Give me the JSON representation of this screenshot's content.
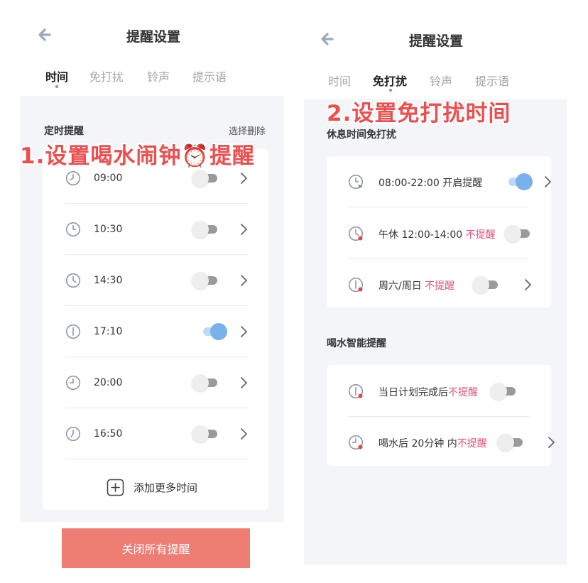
{
  "left": {
    "title": "提醒设置",
    "tabs": [
      {
        "label": "时间",
        "active": true
      },
      {
        "label": "免打扰",
        "active": false
      },
      {
        "label": "铃声",
        "active": false
      },
      {
        "label": "提示语",
        "active": false
      }
    ],
    "section_label": "定时提醒",
    "select_delete_label": "选择删除",
    "annotation": "1.设置喝水闹钟⏰提醒",
    "reminders": [
      {
        "time": "09:00",
        "enabled": false
      },
      {
        "time": "10:30",
        "enabled": false
      },
      {
        "time": "14:30",
        "enabled": false
      },
      {
        "time": "17:10",
        "enabled": true
      },
      {
        "time": "20:00",
        "enabled": false
      },
      {
        "time": "16:50",
        "enabled": false
      }
    ],
    "add_more_label": "添加更多时间",
    "close_all_label": "关闭所有提醒"
  },
  "right": {
    "title": "提醒设置",
    "tabs": [
      {
        "label": "时间",
        "active": false
      },
      {
        "label": "免打扰",
        "active": true
      },
      {
        "label": "铃声",
        "active": false
      },
      {
        "label": "提示语",
        "active": false
      }
    ],
    "annotation": "2.设置免打扰时间",
    "dnd_section_label": "休息时间免打扰",
    "dnd_items": [
      {
        "text": "08:00-22:00 开启提醒",
        "red_text": "",
        "enabled": true,
        "chevron": true,
        "status": "green"
      },
      {
        "text": "午休 12:00-14:00 ",
        "red_text": "不提醒",
        "enabled": false,
        "chevron": false,
        "status": "red"
      },
      {
        "text": "周六/周日 ",
        "red_text": "不提醒",
        "enabled": false,
        "chevron": true,
        "status": "red"
      }
    ],
    "smart_section_label": "喝水智能提醒",
    "smart_items": [
      {
        "text": "当日计划完成后",
        "red_text": "不提醒",
        "enabled": false,
        "chevron": false,
        "status": "red"
      },
      {
        "text": "喝水后 20分钟 内",
        "red_text": "不提醒",
        "enabled": false,
        "chevron": true,
        "status": "red"
      }
    ]
  },
  "colors": {
    "accent_red": "#ee4e4e",
    "button_red": "#ee7d73",
    "toggle_on": "#78b1ec",
    "highlight_text": "#e0557a",
    "icon_color": "#8a91a6"
  }
}
